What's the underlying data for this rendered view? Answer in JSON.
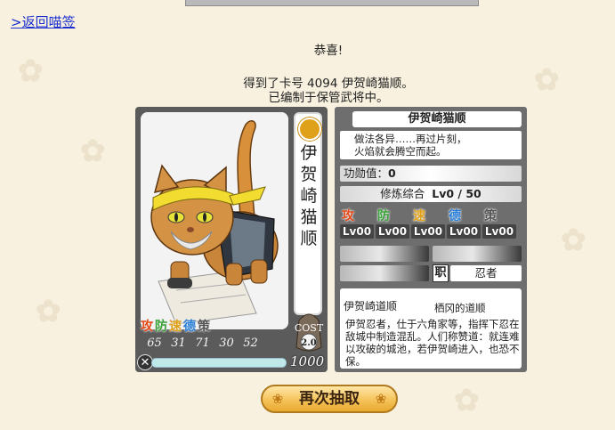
{
  "nav": {
    "back_link": ">返回喵签"
  },
  "message": {
    "congrats": "恭喜!",
    "line1": "得到了卡号 4094 伊贺崎猫顺。",
    "line2": "已编制于保管武将中。"
  },
  "card": {
    "name_vertical": "伊贺崎猫顺",
    "cost_label": "COST",
    "cost_value": "2.0",
    "stat_labels": [
      "攻",
      "防",
      "速",
      "德",
      "策"
    ],
    "stat_values": [
      "65",
      "31",
      "71",
      "30",
      "52"
    ],
    "hp_value": "1000",
    "hp_fraction": 1.0
  },
  "panel": {
    "title": "伊贺崎猫顺",
    "quote_line1": "做法各异……再过片刻，",
    "quote_line2": "火焰就会腾空而起。",
    "merit_label": "功勋值：",
    "merit_value": "0",
    "training_label": "修炼综合",
    "training_value": "Lv0 / 50",
    "attr_labels": [
      "攻",
      "防",
      "速",
      "德",
      "策"
    ],
    "attr_levels": [
      "Lv00",
      "Lv00",
      "Lv00",
      "Lv00",
      "Lv00"
    ],
    "job_marker": "职",
    "job_value": "忍者",
    "desc_tab1": "伊贺崎道顺",
    "desc_tab2": "栖冈的道顺",
    "desc_text": "伊贺忍者，仕于六角家等，指挥下忍在敌城中制造混乱。人们称赞道：就连难以攻破的城池，若伊贺崎进入，也恐不保。"
  },
  "action": {
    "draw_again": "再次抽取"
  },
  "colors": {
    "fire": "#e84b1a",
    "water": "#2a7fd6",
    "earth": "#3aa33a",
    "wind": "#e0a11a",
    "dark": "#555555"
  }
}
